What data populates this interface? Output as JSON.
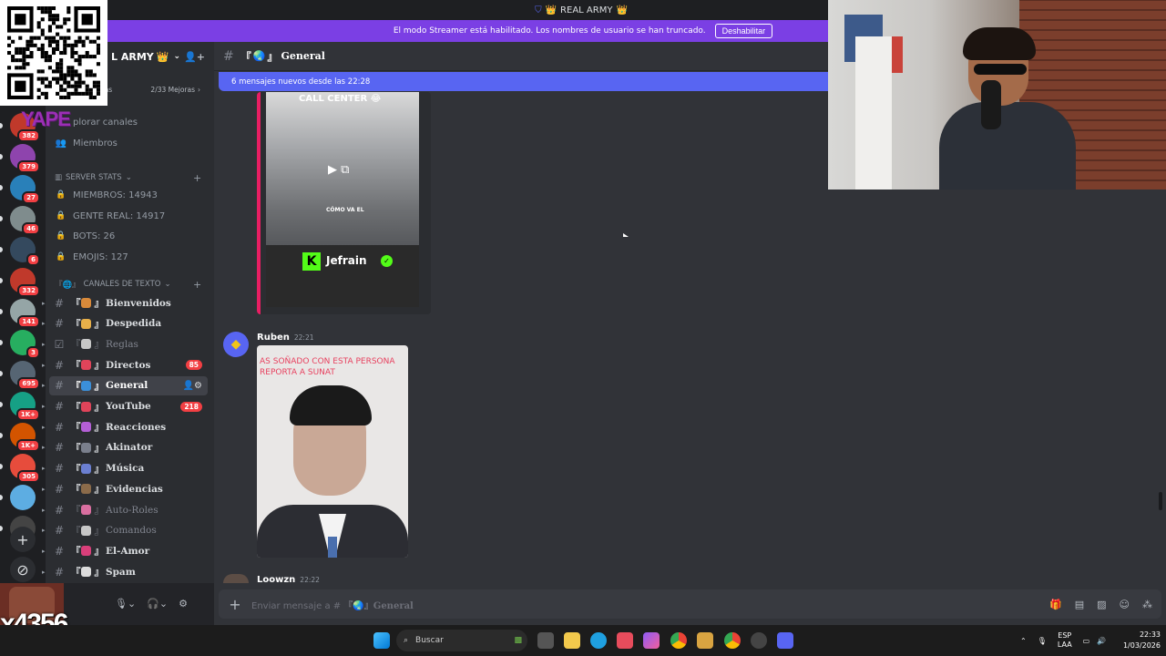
{
  "window": {
    "title": "REAL ARMY",
    "title_crown": "👑"
  },
  "banner": {
    "text": "El modo Streamer está habilitado. Los nombres de usuario se han truncado.",
    "button_label": "Deshabilitar"
  },
  "server": {
    "name": "L ARMY",
    "crown": "👑",
    "boost_label": "eras",
    "boost_count": "2/33 Mejoras",
    "nav": [
      {
        "icon": "🔍",
        "label": "plorar canales"
      },
      {
        "icon": "👥",
        "label": "Miembros"
      }
    ],
    "stats_category": "SERVER STATS",
    "stats": [
      "MIEMBROS: 14943",
      "GENTE REAL: 14917",
      "BOTS: 26",
      "EMOJIS: 127"
    ],
    "text_category": "CANALES DE TEXTO",
    "channels": [
      {
        "name": "Bienvenidos",
        "prefix": "『",
        "suffix": "』",
        "dim": false,
        "badge": ""
      },
      {
        "name": "Despedida",
        "prefix": "『",
        "suffix": "』",
        "dim": false,
        "badge": ""
      },
      {
        "name": "Reglas",
        "prefix": "『",
        "suffix": "』",
        "dim": true,
        "badge": ""
      },
      {
        "name": "Directos",
        "prefix": "『",
        "suffix": "』",
        "dim": false,
        "badge": "85"
      },
      {
        "name": "General",
        "prefix": "『",
        "suffix": "』",
        "dim": false,
        "badge": ""
      },
      {
        "name": "YouTube",
        "prefix": "『",
        "suffix": "』",
        "dim": false,
        "badge": "218"
      },
      {
        "name": "Reacciones",
        "prefix": "『",
        "suffix": "』",
        "dim": false,
        "badge": ""
      },
      {
        "name": "Akinator",
        "prefix": "『",
        "suffix": "』",
        "dim": false,
        "badge": ""
      },
      {
        "name": "Música",
        "prefix": "『",
        "suffix": "』",
        "dim": false,
        "badge": ""
      },
      {
        "name": "Evidencias",
        "prefix": "『",
        "suffix": "』",
        "dim": false,
        "badge": ""
      },
      {
        "name": "Auto-Roles",
        "prefix": "『",
        "suffix": "』",
        "dim": true,
        "badge": ""
      },
      {
        "name": "Comandos",
        "prefix": "『",
        "suffix": "』",
        "dim": true,
        "badge": ""
      },
      {
        "name": "El-Amor",
        "prefix": "『",
        "suffix": "』",
        "dim": false,
        "badge": ""
      },
      {
        "name": "Spam",
        "prefix": "『",
        "suffix": "』",
        "dim": false,
        "badge": ""
      }
    ]
  },
  "rail_badges": [
    "382",
    "379",
    "27",
    "46",
    "6",
    "332",
    "141",
    "3",
    "695",
    "1K+",
    "1K+",
    "305"
  ],
  "chat": {
    "channel_prefix": "『",
    "channel_suffix": "』",
    "channel_name": "General",
    "new_messages": "6 mensajes nuevos desde las 22:28",
    "embed": {
      "title": "CALL CENTER 😂",
      "overlay": "CÓMO VA EL",
      "brand_letter": "K",
      "brand_name": "Jefrain"
    },
    "messages": [
      {
        "author": "Ruben",
        "time": "22:21",
        "image_caption": "AS SOÑADO CON ESTA PERSONA REPORTA A SUNAT"
      },
      {
        "author": "Loowzn",
        "time": "22:22"
      }
    ],
    "composer_placeholder_prefix": "Enviar mensaje a #",
    "composer_placeholder_channel": "『🌏』General"
  },
  "overlay": {
    "brand": "YAPE",
    "tipper_amount": "x4356"
  },
  "taskbar": {
    "search_label": "Buscar",
    "lang_top": "ESP",
    "lang_bottom": "LAA",
    "time": "22:33",
    "date": "1/03/2026"
  },
  "colors": {
    "accent": "#5865f2",
    "banner": "#7b3fe4",
    "badge": "#f23f43",
    "kick_green": "#53fc18"
  }
}
